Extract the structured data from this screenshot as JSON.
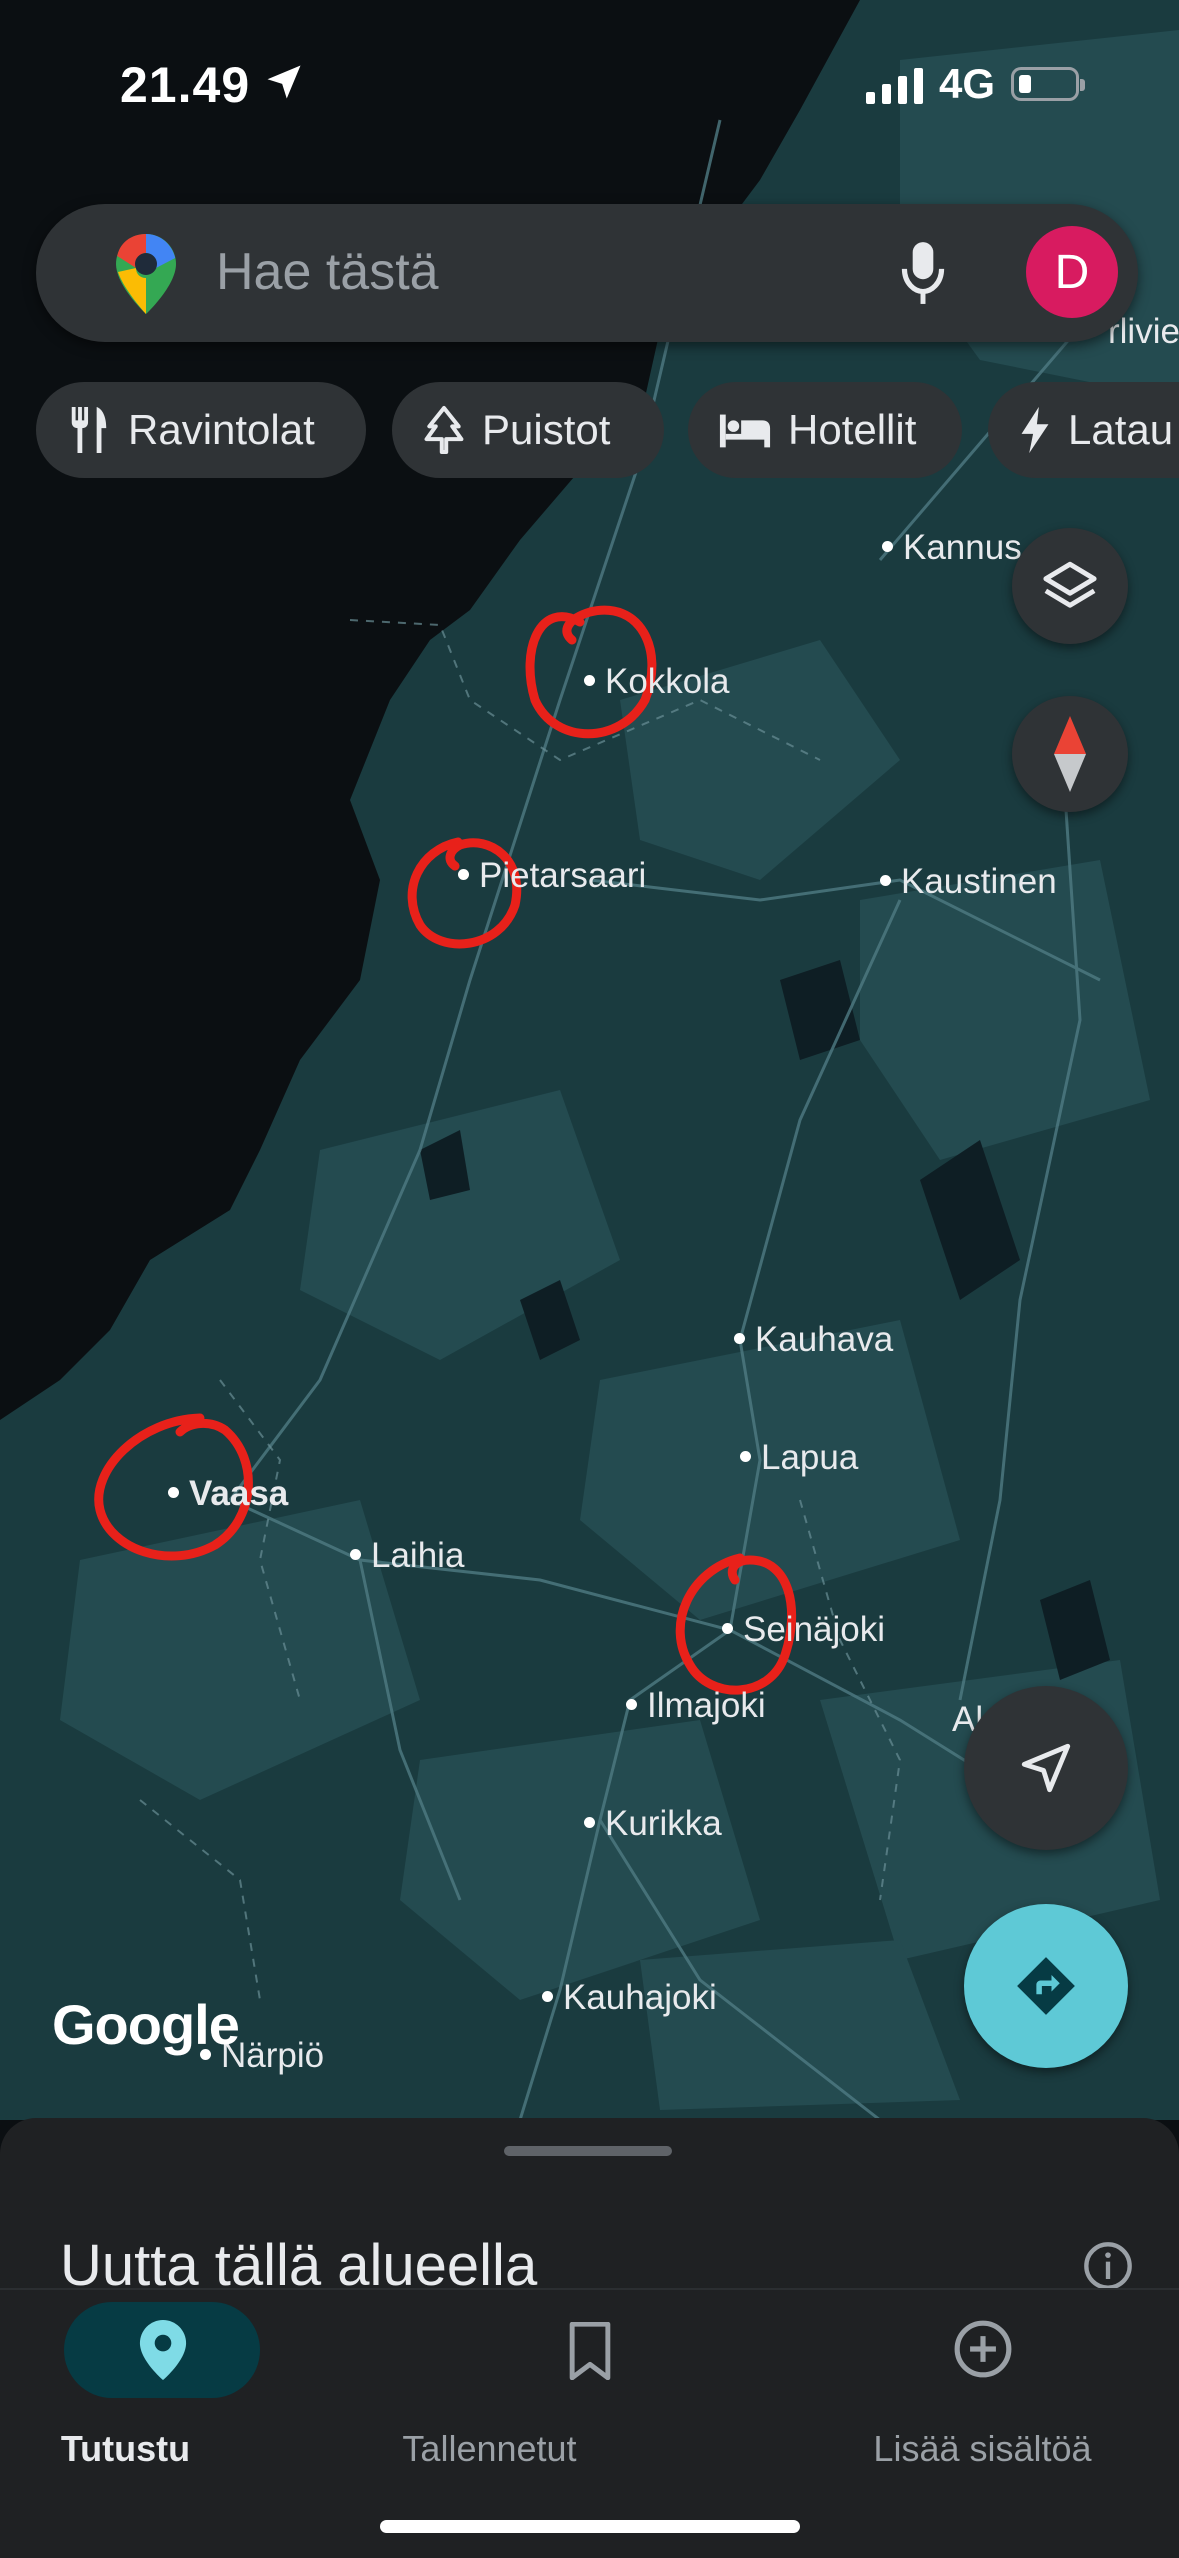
{
  "status_bar": {
    "time": "21.49",
    "network": "4G"
  },
  "search": {
    "placeholder": "Hae tästä",
    "avatar_initial": "D"
  },
  "chips": [
    {
      "label": "Ravintolat",
      "icon": "fork-knife-icon"
    },
    {
      "label": "Puistot",
      "icon": "tree-icon"
    },
    {
      "label": "Hotellit",
      "icon": "bed-icon"
    },
    {
      "label": "Latau",
      "icon": "bolt-icon"
    }
  ],
  "map": {
    "places": [
      "Kokkola",
      "Kannus",
      "Pietarsaari",
      "Kaustinen",
      "Kauhava",
      "Lapua",
      "Vaasa",
      "Laihia",
      "Seinäjoki",
      "Ilmajoki",
      "Kurikka",
      "Kauhajoki",
      "Närpiö"
    ],
    "edge_fragments": [
      "Al",
      "rlivie"
    ],
    "attribution": "Google"
  },
  "sheet": {
    "title": "Uutta tällä alueella"
  },
  "nav": [
    {
      "label": "Tutustu",
      "icon": "location-pin-icon",
      "active": true
    },
    {
      "label": "Tallennetut",
      "icon": "bookmark-icon",
      "active": false
    },
    {
      "label": "Lisää sisältöä",
      "icon": "plus-circle-icon",
      "active": false
    }
  ],
  "colors": {
    "land": "#1a3b3f",
    "land_light": "#244b50",
    "sea": "#0b0f12",
    "circle_annotation": "#e8211a",
    "directions_fab": "#5ec9d6",
    "avatar": "#d81b60",
    "nav_active": "#063b44"
  }
}
